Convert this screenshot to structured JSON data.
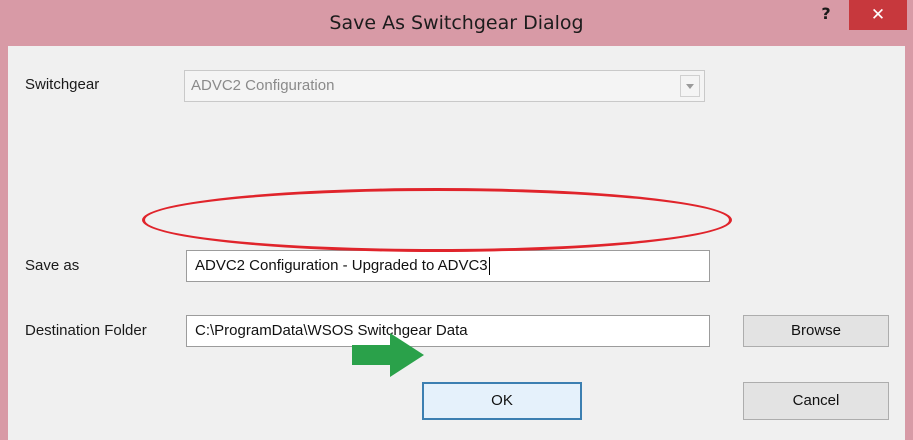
{
  "dialog": {
    "title": "Save As Switchgear Dialog",
    "help_glyph": "?",
    "close_glyph": "✕"
  },
  "form": {
    "switchgear_label": "Switchgear",
    "switchgear_value": "ADVC2 Configuration",
    "save_as_label": "Save as",
    "save_as_value": "ADVC2 Configuration - Upgraded to ADVC3",
    "destination_label": "Destination Folder",
    "destination_value": "C:\\ProgramData\\WSOS Switchgear Data"
  },
  "buttons": {
    "browse": "Browse",
    "ok": "OK",
    "cancel": "Cancel"
  },
  "annotation": {
    "ellipse_color": "#e0242b",
    "arrow_color": "#2aa14a"
  },
  "colors": {
    "titlebar": "#d89aa6",
    "close_button": "#c7383d",
    "client_bg": "#f0f0f0"
  }
}
